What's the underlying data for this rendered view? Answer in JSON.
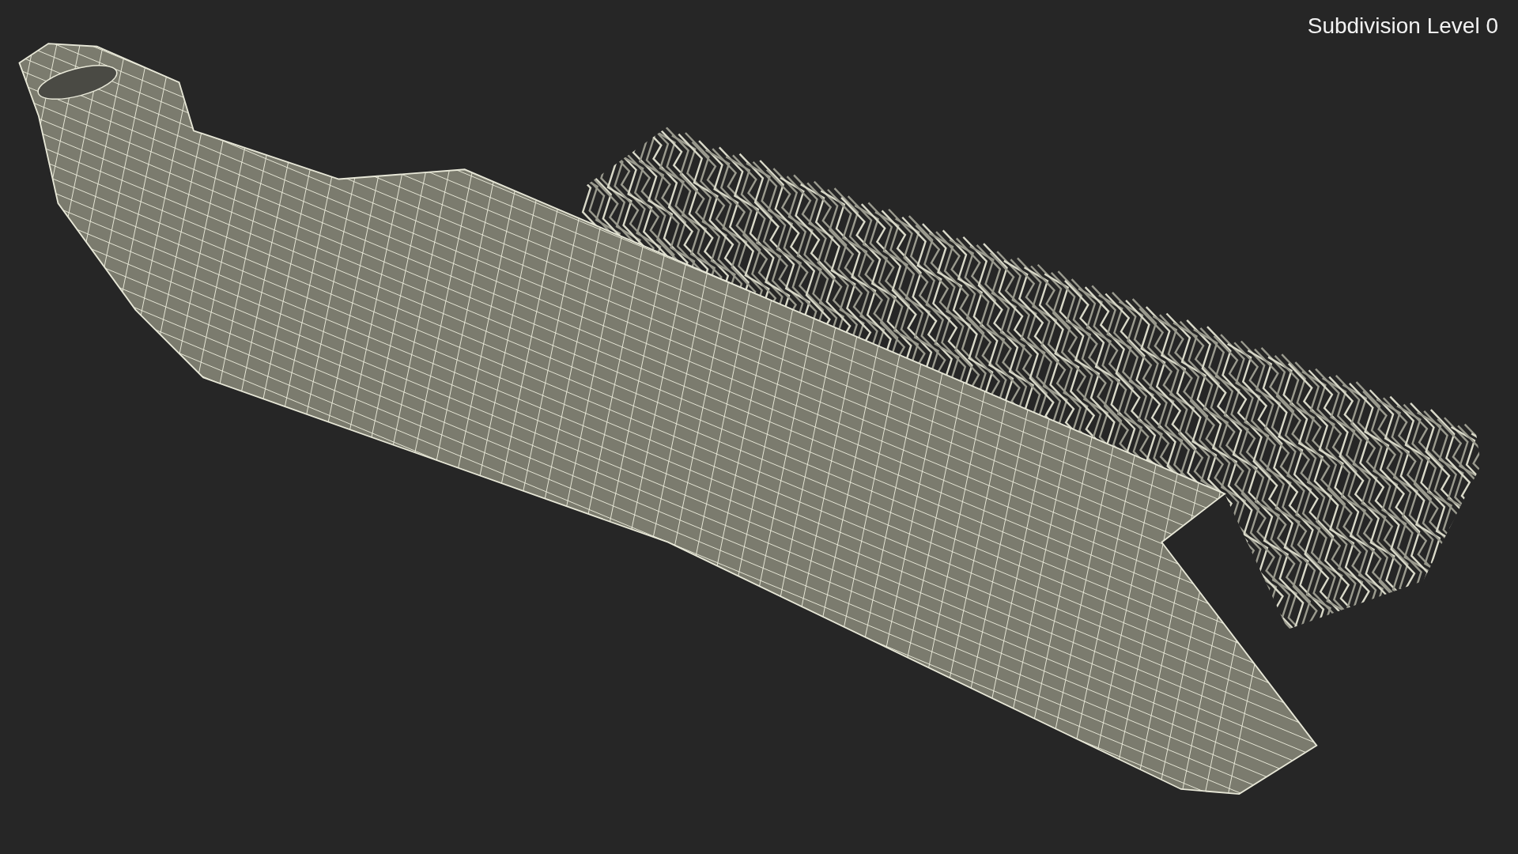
{
  "viewport": {
    "label": "Subdivision Level 0"
  }
}
